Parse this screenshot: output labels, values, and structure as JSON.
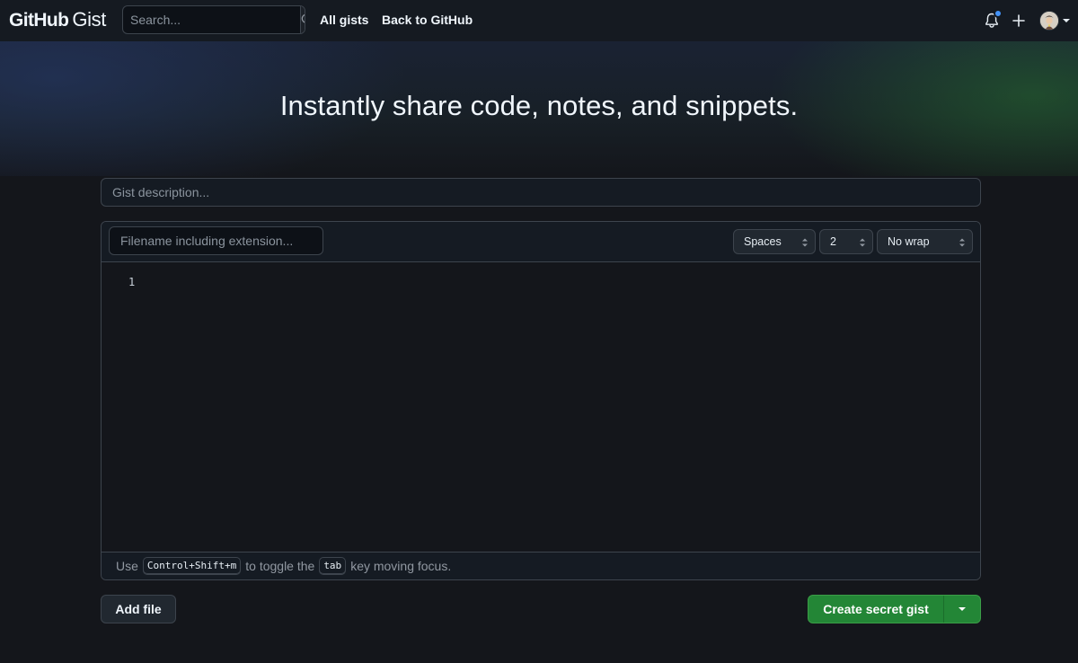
{
  "header": {
    "logo_bold": "GitHub",
    "logo_light": "Gist",
    "search": {
      "placeholder": "Search...",
      "value": ""
    },
    "nav": [
      {
        "label": "All gists"
      },
      {
        "label": "Back to GitHub"
      }
    ],
    "icons": [
      "bell-icon",
      "plus-icon",
      "avatar"
    ],
    "notification_indicator_color": "#4493f8"
  },
  "hero": {
    "title": "Instantly share code, notes, and snippets."
  },
  "form": {
    "description": {
      "placeholder": "Gist description...",
      "value": ""
    },
    "file": {
      "filename": {
        "placeholder": "Filename including extension...",
        "value": ""
      },
      "indent_mode": "Spaces",
      "indent_size": "2",
      "wrap_mode": "No wrap",
      "line_numbers": [
        "1"
      ]
    },
    "footer_hint": {
      "prefix": "Use",
      "shortcut": "Control+Shift+m",
      "middle": "to toggle the",
      "key": "tab",
      "suffix": "key moving focus."
    },
    "add_file_label": "Add file",
    "create_label": "Create secret gist"
  },
  "colors": {
    "background": "#14161b",
    "primary_button": "#238636",
    "border": "#3d444d"
  }
}
